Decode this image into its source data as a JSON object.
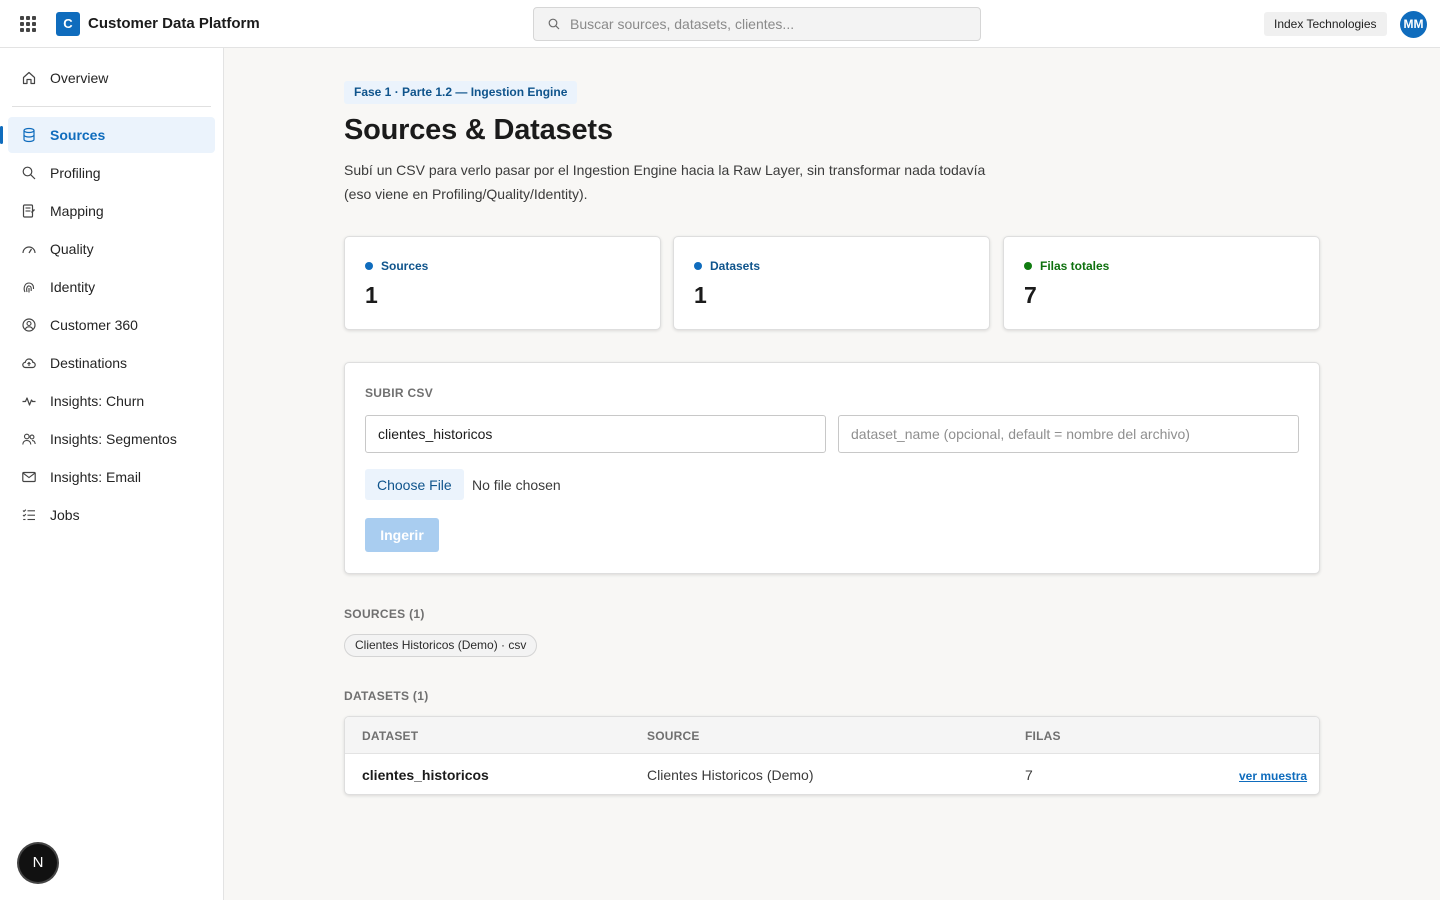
{
  "header": {
    "app_logo_letter": "C",
    "app_title": "Customer Data Platform",
    "search_placeholder": "Buscar sources, datasets, clientes...",
    "org_name": "Index Technologies",
    "user_initials": "MM"
  },
  "sidebar": {
    "overview": "Overview",
    "items": [
      {
        "label": "Sources",
        "icon": "database-icon",
        "active": true
      },
      {
        "label": "Profiling",
        "icon": "search-icon",
        "active": false
      },
      {
        "label": "Mapping",
        "icon": "mapping-icon",
        "active": false
      },
      {
        "label": "Quality",
        "icon": "gauge-icon",
        "active": false
      },
      {
        "label": "Identity",
        "icon": "fingerprint-icon",
        "active": false
      },
      {
        "label": "Customer 360",
        "icon": "person-circle-icon",
        "active": false
      },
      {
        "label": "Destinations",
        "icon": "cloud-upload-icon",
        "active": false
      },
      {
        "label": "Insights: Churn",
        "icon": "pulse-icon",
        "active": false
      },
      {
        "label": "Insights: Segmentos",
        "icon": "people-icon",
        "active": false
      },
      {
        "label": "Insights: Email",
        "icon": "mail-icon",
        "active": false
      },
      {
        "label": "Jobs",
        "icon": "task-list-icon",
        "active": false
      }
    ],
    "dev_badge": "N"
  },
  "main": {
    "phase_tag": "Fase 1 · Parte 1.2 — Ingestion Engine",
    "title": "Sources & Datasets",
    "description": "Subí un CSV para verlo pasar por el Ingestion Engine hacia la Raw Layer, sin transformar nada todavía (eso viene en Profiling/Quality/Identity).",
    "stats": [
      {
        "label": "Sources",
        "value": "1",
        "color": "#0f6cbd"
      },
      {
        "label": "Datasets",
        "value": "1",
        "color": "#0f6cbd"
      },
      {
        "label": "Filas totales",
        "value": "7",
        "color": "#107c10"
      }
    ],
    "upload": {
      "heading": "SUBIR CSV",
      "source_name_value": "clientes_historicos",
      "dataset_name_placeholder": "dataset_name (opcional, default = nombre del archivo)",
      "choose_file_label": "Choose File",
      "file_status": "No file chosen",
      "ingest_label": "Ingerir"
    },
    "sources_section": {
      "heading": "SOURCES (1)",
      "chips": [
        "Clientes Historicos (Demo) · csv"
      ]
    },
    "datasets_section": {
      "heading": "DATASETS (1)",
      "columns": [
        "DATASET",
        "SOURCE",
        "FILAS"
      ],
      "rows": [
        {
          "dataset": "clientes_historicos",
          "source": "Clientes Historicos (Demo)",
          "rows": "7",
          "action": "ver muestra"
        }
      ]
    }
  }
}
